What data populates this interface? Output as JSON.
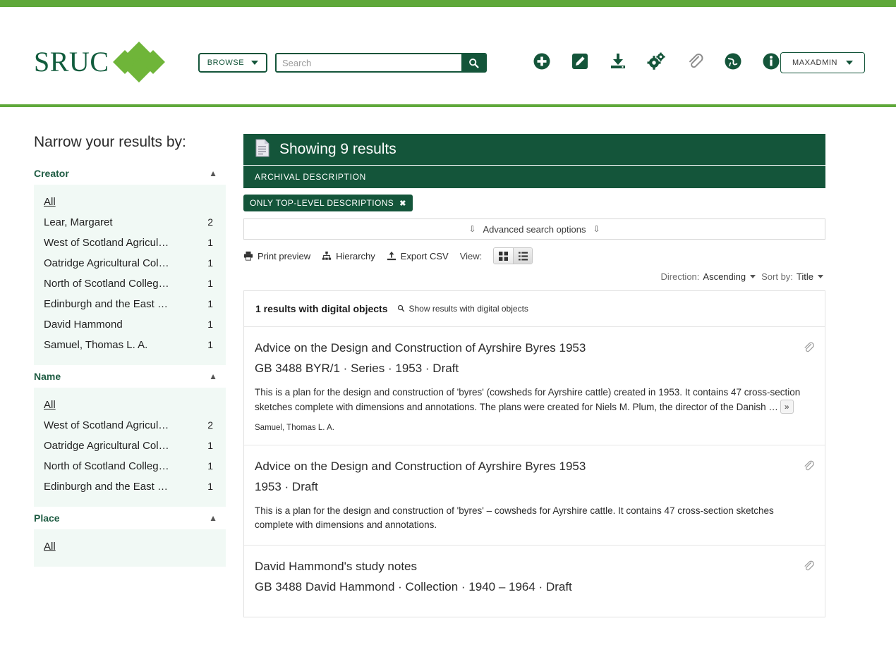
{
  "brand": {
    "logo_text": "SRUC",
    "accent_green": "#5FA83A",
    "dark_green": "#14553A",
    "diamond_green": "#6FB539"
  },
  "header": {
    "browse_label": "BROWSE",
    "search_placeholder": "Search",
    "user_label": "MAXADMIN",
    "icons": [
      {
        "name": "add-icon",
        "title": "Add"
      },
      {
        "name": "edit-icon",
        "title": "Edit"
      },
      {
        "name": "import-icon",
        "title": "Import"
      },
      {
        "name": "settings-gears-icon",
        "title": "Admin"
      },
      {
        "name": "clipboard-icon",
        "title": "Clipboard"
      },
      {
        "name": "globe-icon",
        "title": "Language"
      },
      {
        "name": "info-icon",
        "title": "Help"
      }
    ]
  },
  "sidebar": {
    "title": "Narrow your results by:",
    "facets": [
      {
        "label": "Creator",
        "collapse_icon": "chevron-up-icon",
        "items": [
          {
            "label": "All",
            "count": "",
            "is_all": true
          },
          {
            "label": "Lear, Margaret",
            "count": "2"
          },
          {
            "label": "West of Scotland Agricul…",
            "count": "1"
          },
          {
            "label": "Oatridge Agricultural Col…",
            "count": "1"
          },
          {
            "label": "North of Scotland Colleg…",
            "count": "1"
          },
          {
            "label": "Edinburgh and the East …",
            "count": "1"
          },
          {
            "label": "David Hammond",
            "count": "1"
          },
          {
            "label": "Samuel, Thomas L. A.",
            "count": "1"
          }
        ]
      },
      {
        "label": "Name",
        "collapse_icon": "chevron-up-icon",
        "items": [
          {
            "label": "All",
            "count": "",
            "is_all": true
          },
          {
            "label": "West of Scotland Agricul…",
            "count": "2"
          },
          {
            "label": "Oatridge Agricultural Col…",
            "count": "1"
          },
          {
            "label": "North of Scotland Colleg…",
            "count": "1"
          },
          {
            "label": "Edinburgh and the East …",
            "count": "1"
          }
        ]
      },
      {
        "label": "Place",
        "collapse_icon": "chevron-up-icon",
        "items": [
          {
            "label": "All",
            "count": "",
            "is_all": true
          }
        ]
      }
    ]
  },
  "main": {
    "results_heading": "Showing 9 results",
    "results_icon": "document-icon",
    "entity_type": "ARCHIVAL DESCRIPTION",
    "filter_tag": {
      "label": "ONLY TOP-LEVEL DESCRIPTIONS",
      "remove": "✖"
    },
    "advanced_search": "Advanced search options",
    "toolbar": {
      "print_preview": "Print preview",
      "hierarchy": "Hierarchy",
      "export_csv": "Export CSV",
      "view_label": "View:",
      "view_grid": "grid-view-icon",
      "view_list": "list-view-icon"
    },
    "sort": {
      "direction_label": "Direction:",
      "direction_value": "Ascending",
      "sortby_label": "Sort by:",
      "sortby_value": "Title"
    },
    "digital_objects": {
      "count_text": "1 results with digital objects",
      "show_link": "Show results with digital objects"
    },
    "items": [
      {
        "title": "Advice on the Design and Construction of Ayrshire Byres 1953",
        "meta": "GB 3488 BYR/1 ·  Series ·  1953 ·  Draft",
        "desc": "This is a plan for the design and construction of 'byres' (cowsheds for Ayrshire cattle) created in 1953. It contains 47 cross-section sketches complete with dimensions and annotations. The plans were created for Niels M. Plum, the director of the Danish …",
        "more": "»",
        "creator": "Samuel, Thomas L. A.",
        "clip": "paperclip-icon"
      },
      {
        "title": "Advice on the Design and Construction of Ayrshire Byres 1953",
        "meta": "1953 ·  Draft",
        "desc": "This is a plan for the design and construction of 'byres' – cowsheds for Ayrshire cattle. It contains 47 cross-section sketches complete with dimensions and annotations.",
        "more": "",
        "creator": "",
        "clip": "paperclip-icon"
      },
      {
        "title": "David Hammond's study notes",
        "meta": "GB 3488 David Hammond ·  Collection ·  1940 – 1964 ·  Draft",
        "desc": "",
        "more": "",
        "creator": "",
        "clip": "paperclip-icon"
      }
    ]
  }
}
